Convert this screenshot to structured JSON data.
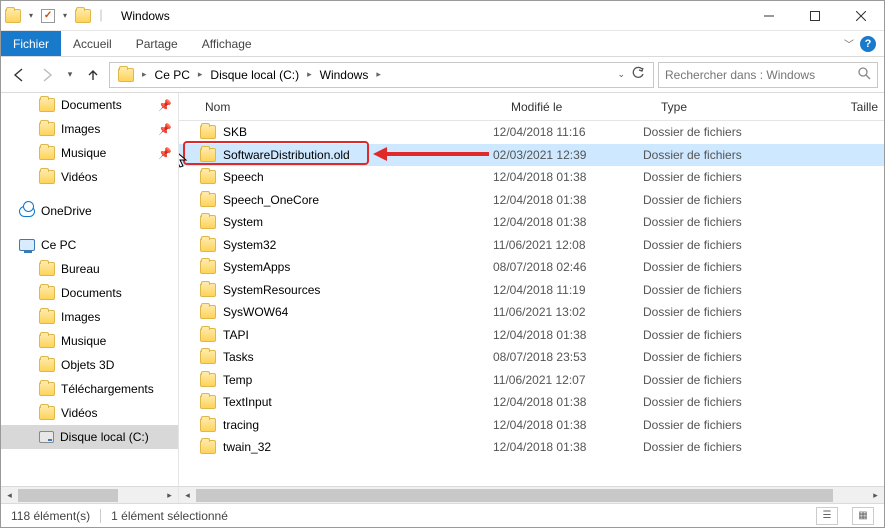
{
  "window": {
    "title": "Windows"
  },
  "ribbon": {
    "file": "Fichier",
    "home": "Accueil",
    "share": "Partage",
    "view": "Affichage"
  },
  "breadcrumb": {
    "seg0": "Ce PC",
    "seg1": "Disque local (C:)",
    "seg2": "Windows"
  },
  "search": {
    "placeholder": "Rechercher dans : Windows"
  },
  "nav": {
    "documents": "Documents",
    "images": "Images",
    "musique": "Musique",
    "videos": "Vidéos",
    "onedrive": "OneDrive",
    "cepc": "Ce PC",
    "bureau": "Bureau",
    "documents2": "Documents",
    "images2": "Images",
    "musique2": "Musique",
    "objets3d": "Objets 3D",
    "telech": "Téléchargements",
    "videos2": "Vidéos",
    "disque": "Disque local (C:)"
  },
  "columns": {
    "name": "Nom",
    "modified": "Modifié le",
    "type": "Type",
    "size": "Taille"
  },
  "type_folder": "Dossier de fichiers",
  "rows": [
    {
      "name": "SKB",
      "mod": "12/04/2018 11:16"
    },
    {
      "name": "SoftwareDistribution.old",
      "mod": "02/03/2021 12:39",
      "selected": true
    },
    {
      "name": "Speech",
      "mod": "12/04/2018 01:38"
    },
    {
      "name": "Speech_OneCore",
      "mod": "12/04/2018 01:38"
    },
    {
      "name": "System",
      "mod": "12/04/2018 01:38"
    },
    {
      "name": "System32",
      "mod": "11/06/2021 12:08"
    },
    {
      "name": "SystemApps",
      "mod": "08/07/2018 02:46"
    },
    {
      "name": "SystemResources",
      "mod": "12/04/2018 11:19"
    },
    {
      "name": "SysWOW64",
      "mod": "11/06/2021 13:02"
    },
    {
      "name": "TAPI",
      "mod": "12/04/2018 01:38"
    },
    {
      "name": "Tasks",
      "mod": "08/07/2018 23:53"
    },
    {
      "name": "Temp",
      "mod": "11/06/2021 12:07"
    },
    {
      "name": "TextInput",
      "mod": "12/04/2018 01:38"
    },
    {
      "name": "tracing",
      "mod": "12/04/2018 01:38"
    },
    {
      "name": "twain_32",
      "mod": "12/04/2018 01:38"
    }
  ],
  "status": {
    "count": "118 élément(s)",
    "selected": "1 élément sélectionné"
  }
}
